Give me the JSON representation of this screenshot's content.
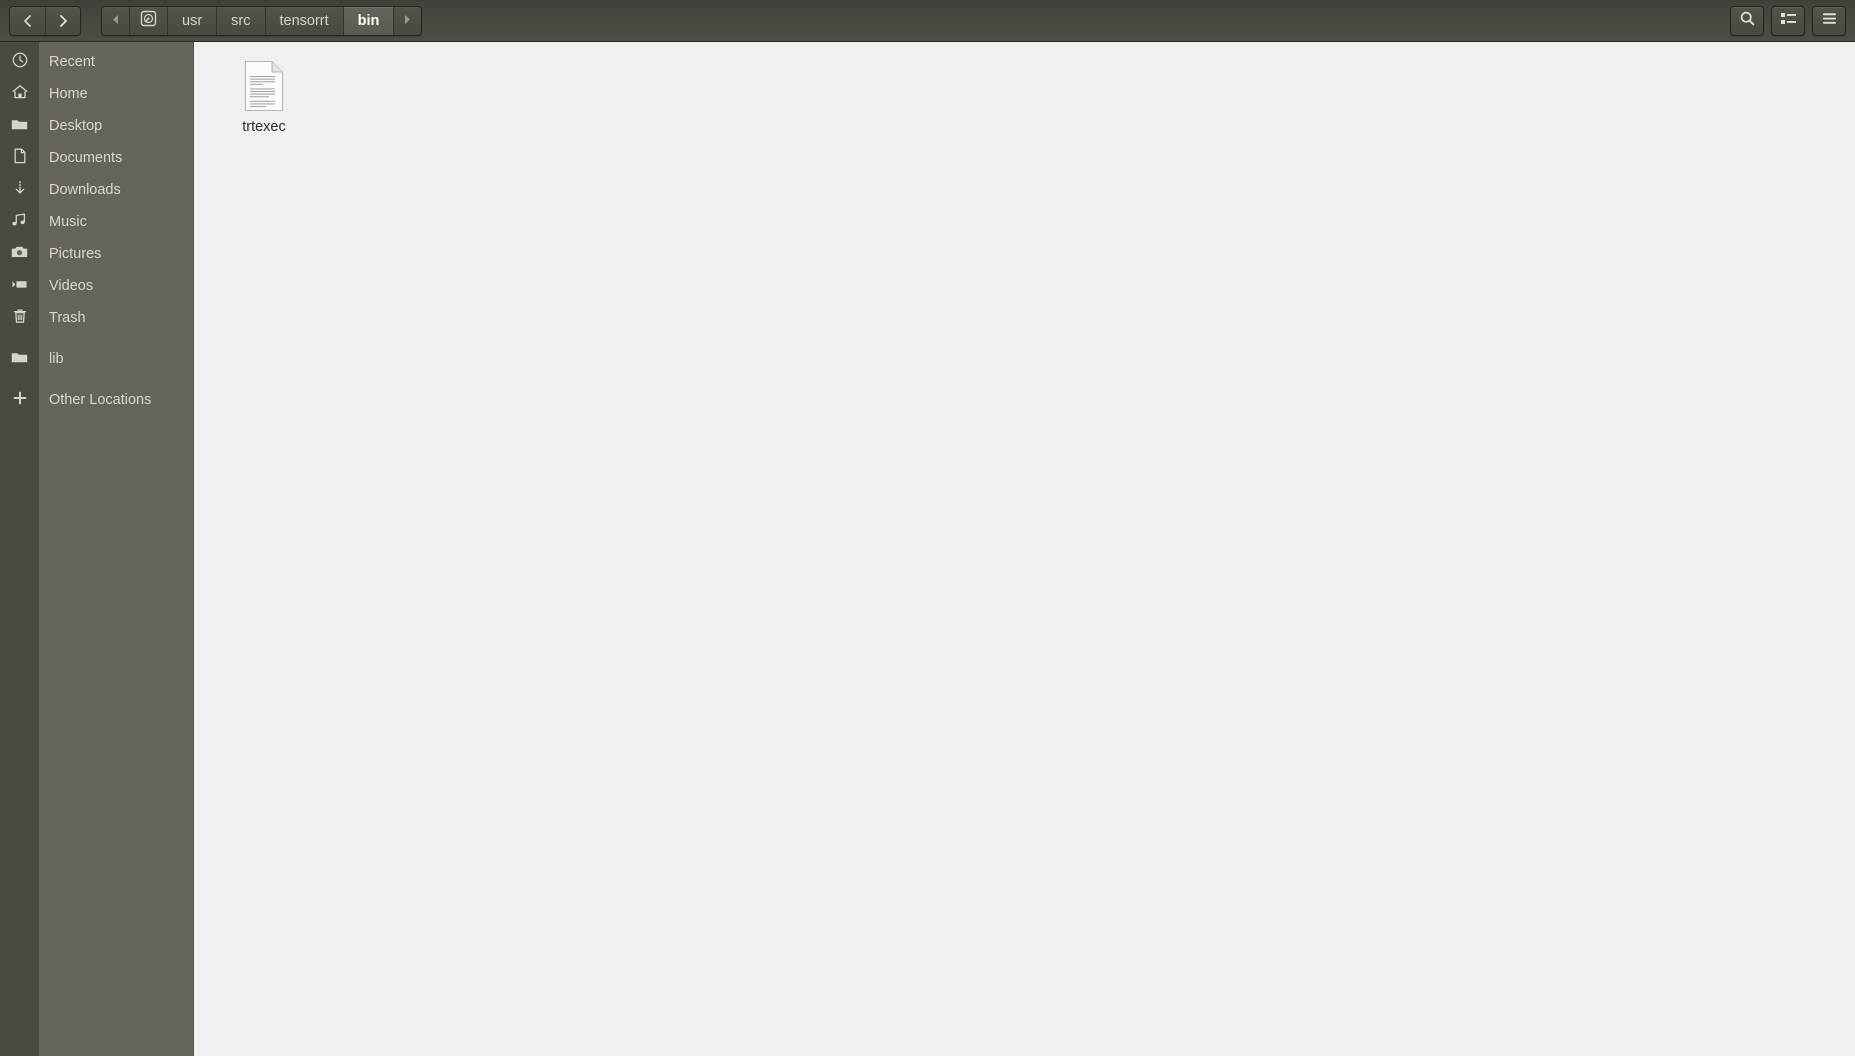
{
  "window": {
    "title": "bin",
    "app": "Files"
  },
  "header": {
    "nav": {
      "back_label": "Back",
      "back_icon": "chevron-left-icon",
      "forward_label": "Forward",
      "forward_icon": "chevron-right-icon"
    },
    "pathbar": {
      "scroll_left_icon": "triangle-left-icon",
      "scroll_right_icon": "triangle-right-icon",
      "root_icon": "hard-disk-icon",
      "root_label": "",
      "crumbs": [
        {
          "label": "usr",
          "active": false
        },
        {
          "label": "src",
          "active": false
        },
        {
          "label": "tensorrt",
          "active": false
        },
        {
          "label": "bin",
          "active": true
        }
      ]
    },
    "actions": [
      {
        "name": "search-button",
        "icon": "search-icon",
        "label": "Search"
      },
      {
        "name": "view-options-button",
        "icon": "list-view-icon",
        "label": "View options"
      },
      {
        "name": "main-menu-button",
        "icon": "hamburger-menu-icon",
        "label": "Menu"
      }
    ]
  },
  "sidebar": {
    "items": [
      {
        "label": "Recent",
        "icon": "clock-icon"
      },
      {
        "label": "Home",
        "icon": "house-icon"
      },
      {
        "label": "Desktop",
        "icon": "folder-icon"
      },
      {
        "label": "Documents",
        "icon": "document-icon"
      },
      {
        "label": "Downloads",
        "icon": "download-arrow-icon"
      },
      {
        "label": "Music",
        "icon": "music-note-icon"
      },
      {
        "label": "Pictures",
        "icon": "camera-icon"
      },
      {
        "label": "Videos",
        "icon": "video-camera-icon"
      },
      {
        "label": "Trash",
        "icon": "trash-can-icon"
      }
    ],
    "bookmarks": [
      {
        "label": "lib",
        "icon": "folder-icon"
      }
    ],
    "other": {
      "label": "Other Locations",
      "icon": "plus-icon"
    }
  },
  "content": {
    "files": [
      {
        "name": "trtexec",
        "icon": "text-file-icon",
        "selected": false
      }
    ]
  },
  "colors": {
    "header_top": "#3f3e38",
    "header_bottom": "#4e4c45",
    "icon_rail": "#4b4941",
    "sidebar": "#65635a",
    "content_bg": "#f1f0ee",
    "sidebar_text": "#d9d6ce",
    "active_crumb_text": "#ffffff",
    "file_label_text": "#2d2d2b"
  }
}
